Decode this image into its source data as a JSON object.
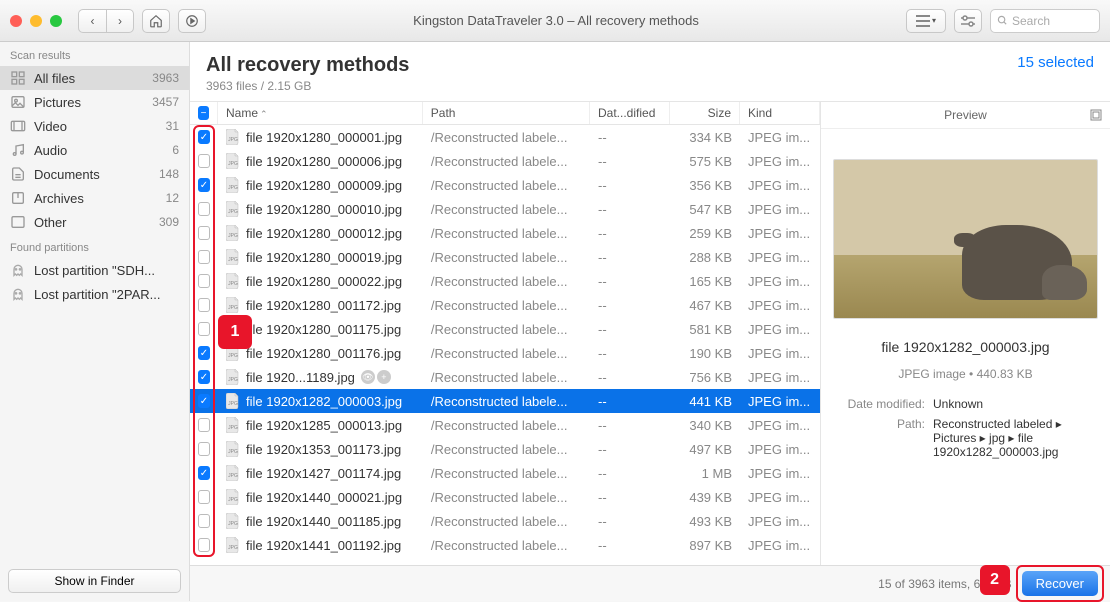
{
  "window": {
    "title": "Kingston DataTraveler 3.0 – All recovery methods",
    "search_placeholder": "Search"
  },
  "sidebar": {
    "scan_results_label": "Scan results",
    "categories": [
      {
        "icon": "all",
        "label": "All files",
        "count": "3963",
        "selected": true
      },
      {
        "icon": "pictures",
        "label": "Pictures",
        "count": "3457"
      },
      {
        "icon": "video",
        "label": "Video",
        "count": "31"
      },
      {
        "icon": "audio",
        "label": "Audio",
        "count": "6"
      },
      {
        "icon": "documents",
        "label": "Documents",
        "count": "148"
      },
      {
        "icon": "archives",
        "label": "Archives",
        "count": "12"
      },
      {
        "icon": "other",
        "label": "Other",
        "count": "309"
      }
    ],
    "partitions_label": "Found partitions",
    "partitions": [
      {
        "label": "Lost partition \"SDH..."
      },
      {
        "label": "Lost partition \"2PAR..."
      }
    ],
    "finder_button": "Show in Finder"
  },
  "header": {
    "title": "All recovery methods",
    "subtitle": "3963 files / 2.15 GB",
    "selected": "15 selected"
  },
  "columns": {
    "name": "Name",
    "path": "Path",
    "date": "Dat...dified",
    "size": "Size",
    "kind": "Kind"
  },
  "files": [
    {
      "checked": true,
      "name": "file 1920x1280_000001.jpg",
      "path": "/Reconstructed labele...",
      "date": "--",
      "size": "334 KB",
      "kind": "JPEG im..."
    },
    {
      "checked": false,
      "name": "file 1920x1280_000006.jpg",
      "path": "/Reconstructed labele...",
      "date": "--",
      "size": "575 KB",
      "kind": "JPEG im..."
    },
    {
      "checked": true,
      "name": "file 1920x1280_000009.jpg",
      "path": "/Reconstructed labele...",
      "date": "--",
      "size": "356 KB",
      "kind": "JPEG im..."
    },
    {
      "checked": false,
      "name": "file 1920x1280_000010.jpg",
      "path": "/Reconstructed labele...",
      "date": "--",
      "size": "547 KB",
      "kind": "JPEG im..."
    },
    {
      "checked": false,
      "name": "file 1920x1280_000012.jpg",
      "path": "/Reconstructed labele...",
      "date": "--",
      "size": "259 KB",
      "kind": "JPEG im..."
    },
    {
      "checked": false,
      "name": "file 1920x1280_000019.jpg",
      "path": "/Reconstructed labele...",
      "date": "--",
      "size": "288 KB",
      "kind": "JPEG im..."
    },
    {
      "checked": false,
      "name": "file 1920x1280_000022.jpg",
      "path": "/Reconstructed labele...",
      "date": "--",
      "size": "165 KB",
      "kind": "JPEG im..."
    },
    {
      "checked": false,
      "name": "file 1920x1280_001172.jpg",
      "path": "/Reconstructed labele...",
      "date": "--",
      "size": "467 KB",
      "kind": "JPEG im..."
    },
    {
      "checked": false,
      "name": "file 1920x1280_001175.jpg",
      "path": "/Reconstructed labele...",
      "date": "--",
      "size": "581 KB",
      "kind": "JPEG im..."
    },
    {
      "checked": true,
      "name": "file 1920x1280_001176.jpg",
      "path": "/Reconstructed labele...",
      "date": "--",
      "size": "190 KB",
      "kind": "JPEG im..."
    },
    {
      "checked": true,
      "name": "file 1920...1189.jpg",
      "path": "/Reconstructed labele...",
      "date": "--",
      "size": "756 KB",
      "kind": "JPEG im...",
      "eye": true
    },
    {
      "checked": true,
      "name": "file 1920x1282_000003.jpg",
      "path": "/Reconstructed labele...",
      "date": "--",
      "size": "441 KB",
      "kind": "JPEG im...",
      "selected": true
    },
    {
      "checked": false,
      "name": "file 1920x1285_000013.jpg",
      "path": "/Reconstructed labele...",
      "date": "--",
      "size": "340 KB",
      "kind": "JPEG im..."
    },
    {
      "checked": false,
      "name": "file 1920x1353_001173.jpg",
      "path": "/Reconstructed labele...",
      "date": "--",
      "size": "497 KB",
      "kind": "JPEG im..."
    },
    {
      "checked": true,
      "name": "file 1920x1427_001174.jpg",
      "path": "/Reconstructed labele...",
      "date": "--",
      "size": "1 MB",
      "kind": "JPEG im..."
    },
    {
      "checked": false,
      "name": "file 1920x1440_000021.jpg",
      "path": "/Reconstructed labele...",
      "date": "--",
      "size": "439 KB",
      "kind": "JPEG im..."
    },
    {
      "checked": false,
      "name": "file 1920x1440_001185.jpg",
      "path": "/Reconstructed labele...",
      "date": "--",
      "size": "493 KB",
      "kind": "JPEG im..."
    },
    {
      "checked": false,
      "name": "file 1920x1441_001192.jpg",
      "path": "/Reconstructed labele...",
      "date": "--",
      "size": "897 KB",
      "kind": "JPEG im..."
    }
  ],
  "preview": {
    "label": "Preview",
    "filename": "file 1920x1282_000003.jpg",
    "meta": "JPEG image • 440.83 KB",
    "date_label": "Date modified:",
    "date_value": "Unknown",
    "path_label": "Path:",
    "path_value": "Reconstructed labeled ▸ Pictures ▸ jpg ▸ file 1920x1282_000003.jpg"
  },
  "footer": {
    "status": "15 of 3963 items, 6.3 MB",
    "recover": "Recover"
  },
  "annotations": {
    "a1": "1",
    "a2": "2"
  }
}
